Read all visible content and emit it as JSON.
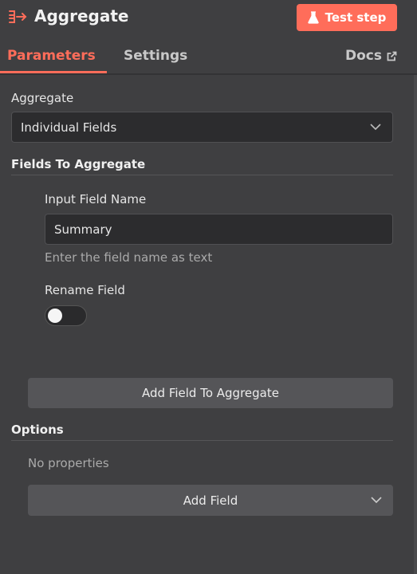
{
  "header": {
    "title": "Aggregate",
    "test_button": "Test step"
  },
  "tabs": {
    "parameters": "Parameters",
    "settings": "Settings",
    "docs": "Docs"
  },
  "aggregate": {
    "label": "Aggregate",
    "value": "Individual Fields"
  },
  "fields_section": {
    "title": "Fields To Aggregate"
  },
  "input_field": {
    "label": "Input Field Name",
    "value": "Summary",
    "hint": "Enter the field name as text"
  },
  "rename_field": {
    "label": "Rename Field",
    "enabled": false
  },
  "add_field_to_aggregate": {
    "label": "Add Field To Aggregate"
  },
  "options": {
    "title": "Options",
    "empty_text": "No properties",
    "add_field_label": "Add Field"
  },
  "colors": {
    "accent": "#ff6d5a",
    "background": "#3f3f41",
    "input_bg": "#2c2c2e",
    "button_bg": "#555558"
  },
  "icons": {
    "node": "aggregate-node-icon",
    "flask": "flask-icon",
    "external": "external-link-icon",
    "chevron": "chevron-down-icon"
  }
}
